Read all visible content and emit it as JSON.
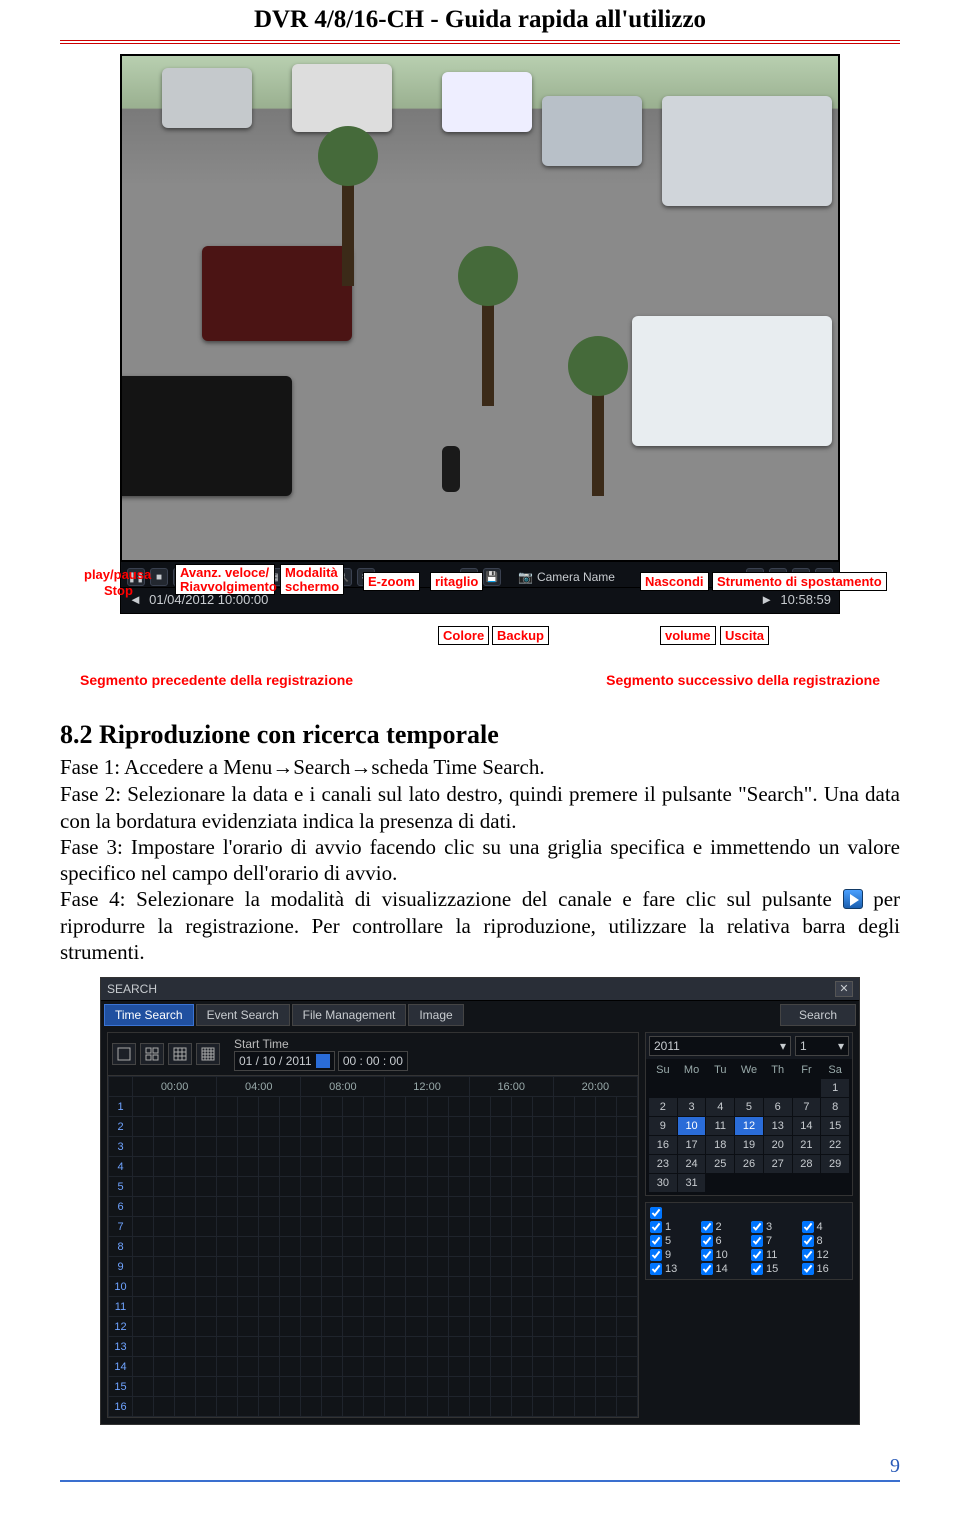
{
  "header": {
    "title": "DVR 4/8/16-CH - Guida rapida all'utilizzo"
  },
  "fig1": {
    "labels": {
      "play_pause": "play/pausa",
      "stop": "Stop",
      "ffwd_rew": "Avanz. veloce/\nRiavvolgimento",
      "mode": "Modalità schermo",
      "ezoom": "E-zoom",
      "crop": "ritaglio",
      "hide": "Nascondi",
      "move_tool": "Strumento di spostamento",
      "color": "Colore",
      "backup": "Backup",
      "volume": "volume",
      "exit": "Uscita"
    },
    "playbar": {
      "camera_name": "Camera Name",
      "timestamp": "01/04/2012 10:00:00",
      "clock": "10:58:59"
    },
    "prev_seg": "Segmento precedente della registrazione",
    "next_seg": "Segmento successivo della registrazione"
  },
  "section": {
    "heading": "8.2  Riproduzione con ricerca temporale",
    "p1a": "Fase 1: Accedere a Menu",
    "p1b": "Search",
    "p1c": "scheda Time Search.",
    "p2": "Fase 2: Selezionare la data e i canali sul lato destro, quindi premere il pulsante \"Search\". Una data con la bordatura evidenziata indica la presenza di dati.",
    "p3": "Fase 3: Impostare l'orario di avvio facendo clic su una griglia specifica e immettendo un valore specifico nel campo dell'orario di avvio.",
    "p4a": "Fase 4: Selezionare la modalità di visualizzazione del canale e fare clic sul pulsante",
    "p4b": " per riprodurre la registrazione. Per controllare la riproduzione, utilizzare la relativa barra degli strumenti."
  },
  "search_win": {
    "title": "SEARCH",
    "tabs": [
      "Time Search",
      "Event Search",
      "File Management",
      "Image"
    ],
    "search_btn": "Search",
    "start_label": "Start Time",
    "start_date": "01 / 10 / 2011",
    "start_time": "00 : 00 : 00",
    "hours": [
      "00:00",
      "04:00",
      "08:00",
      "12:00",
      "16:00",
      "20:00"
    ],
    "channels": [
      "1",
      "2",
      "3",
      "4",
      "5",
      "6",
      "7",
      "8",
      "9",
      "10",
      "11",
      "12",
      "13",
      "14",
      "15",
      "16"
    ],
    "cal": {
      "year": "2011",
      "month": "1",
      "dow": [
        "Su",
        "Mo",
        "Tu",
        "We",
        "Th",
        "Fr",
        "Sa"
      ],
      "leading_blanks": 6,
      "days": 31,
      "selected": [
        10,
        12
      ]
    },
    "checks": [
      "1",
      "2",
      "3",
      "4",
      "5",
      "6",
      "7",
      "8",
      "9",
      "10",
      "11",
      "12",
      "13",
      "14",
      "15",
      "16"
    ]
  },
  "page_number": "9"
}
